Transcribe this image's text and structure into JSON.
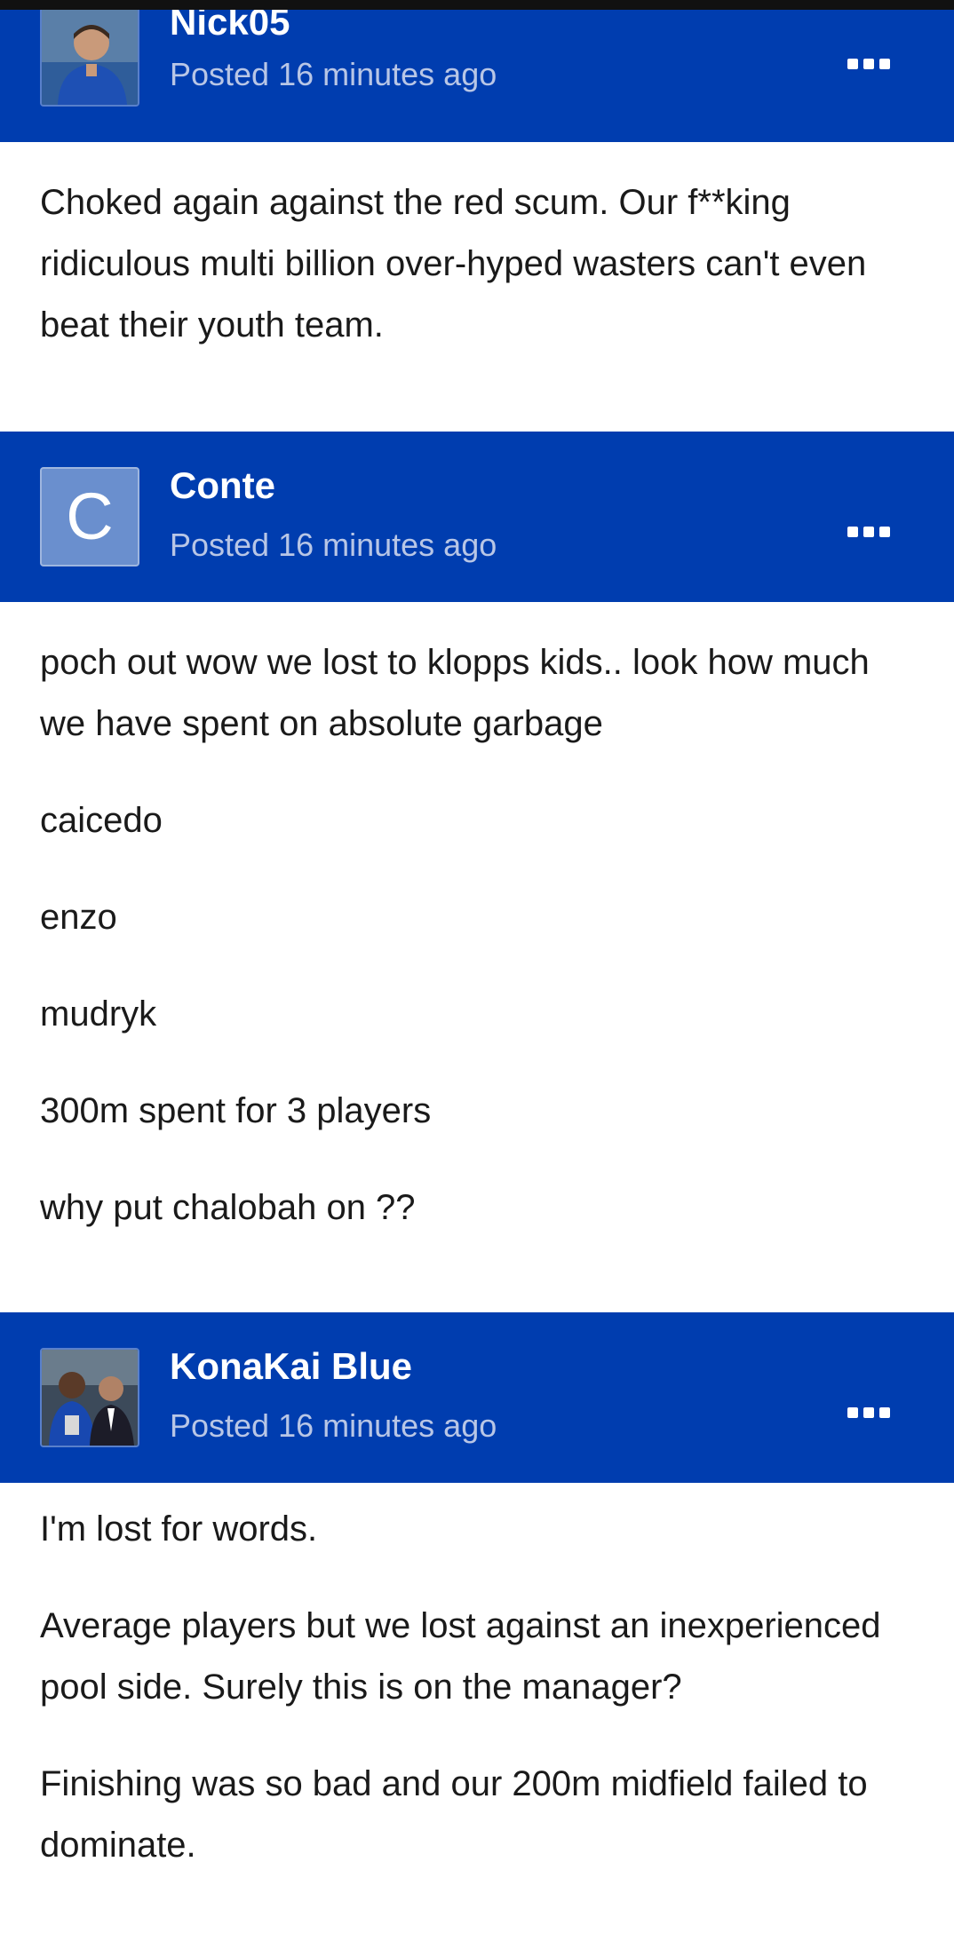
{
  "posts": [
    {
      "author": "Nick05",
      "posted": "Posted 16 minutes ago",
      "avatar_icon": "user-photo-avatar-icon",
      "paragraphs": [
        "Choked again against the red scum. Our f**king ridiculous multi billion over-hyped wasters can't even beat their youth team."
      ]
    },
    {
      "author": "Conte",
      "posted": "Posted 16 minutes ago",
      "avatar_letter": "C",
      "paragraphs": [
        "poch out wow we lost to klopps kids.. look how much we have spent on absolute garbage",
        "caicedo",
        "enzo",
        "mudryk",
        "300m spent for 3 players",
        "why put chalobah on ??"
      ]
    },
    {
      "author": "KonaKai Blue",
      "posted": "Posted 16 minutes ago",
      "avatar_icon": "user-photo-avatar-icon",
      "paragraphs": [
        "I'm lost for words.",
        "Average players but we lost against an inexperienced pool side. Surely this is on the manager?",
        "Finishing was so bad and our 200m midfield failed to dominate."
      ]
    }
  ],
  "colors": {
    "header_bg": "#003daf",
    "posted_text": "#b8c6e6",
    "body_text": "#1a1a1a",
    "letter_avatar_bg": "#6a8fce"
  }
}
